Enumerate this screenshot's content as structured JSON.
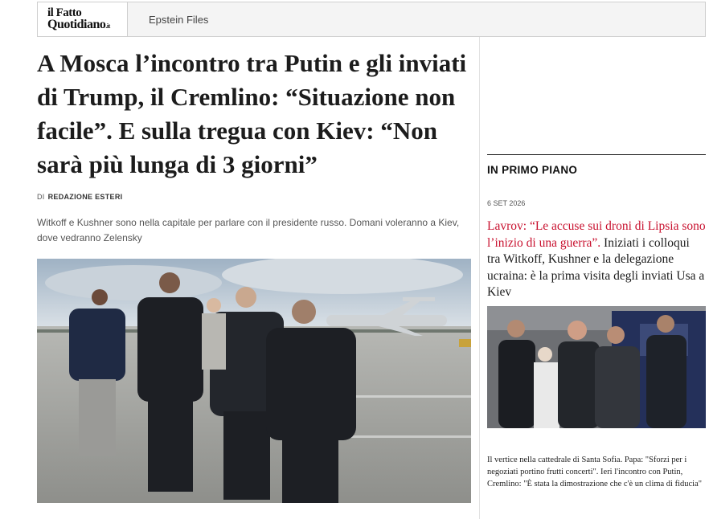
{
  "header": {
    "logo_line1": "il Fatto",
    "logo_line2": "Quotidiano",
    "logo_suffix": ".it",
    "nav_link": "Epstein Files"
  },
  "article": {
    "headline": "A Mosca l’incontro tra Putin e gli inviati di Trump, il Cremlino: “Situazione non facile”. E sulla tregua con Kiev: “Non sarà più lunga di 3 giorni”",
    "byline_prefix": "DI",
    "byline_author": "REDAZIONE ESTERI",
    "summary": "Witkoff e Kushner sono nella capitale per parlare con il presidente russo. Domani voleranno a Kiev, dove vedranno Zelensky"
  },
  "sidebar": {
    "section_title": "IN PRIMO PIANO",
    "date": "6 SET 2026",
    "headline_red": "Lavrov: “Le accuse sui droni di Lipsia sono l’inizio di una guerra”.",
    "headline_rest": " Iniziati i colloqui tra Witkoff, Kushner e la delegazione ucraina: è la prima visita degli inviati Usa a Kiev",
    "caption": "Il vertice nella cattedrale di Santa Sofia. Papa: \"Sforzi per i negoziati portino frutti concerti\". Ieri l'incontro con Putin, Cremlino: \"È stata la dimostrazione che c'è un clima di fiducia\""
  },
  "colors": {
    "accent_red": "#c8102e",
    "text": "#1c1c1c"
  }
}
